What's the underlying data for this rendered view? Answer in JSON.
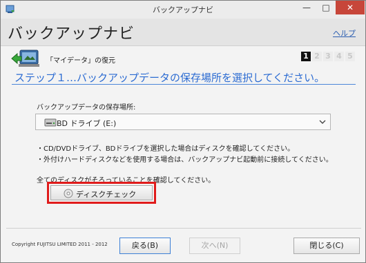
{
  "window": {
    "title": "バックアップナビ",
    "min_symbol": "—",
    "max_symbol": "□",
    "close_symbol": "✕"
  },
  "header": {
    "app_title": "バックアップナビ",
    "help_link": "ヘルプ"
  },
  "step": {
    "subtitle": "「マイデータ」の復元",
    "numbers": [
      "1",
      "2",
      "3",
      "4",
      "5"
    ],
    "active": "1",
    "title": "ステップ１…バックアップデータの保存場所を選択してください。"
  },
  "content": {
    "location_label": "バックアップデータの保存場所:",
    "drive_value": "BD ドライブ (E:)",
    "note1": "・CD/DVDドライブ、BDドライブを選択した場合はディスクを確認してください。",
    "note2": "・外付けハードディスクなどを使用する場合は、バックアップナビ起動前に接続してください。",
    "confirm_text": "全てのディスクがそろっていることを確認してください。",
    "disk_check_button": "ディスクチェック"
  },
  "footer": {
    "copyright": "Copyright FUJITSU LIMITED 2011 - 2012",
    "back_button": "戻る(B)",
    "next_button": "次へ(N)",
    "close_button": "閉じる(C)"
  },
  "colors": {
    "accent_blue": "#2b6bd2",
    "highlight_red": "#e01b1b",
    "active_step_bg": "#111111"
  }
}
